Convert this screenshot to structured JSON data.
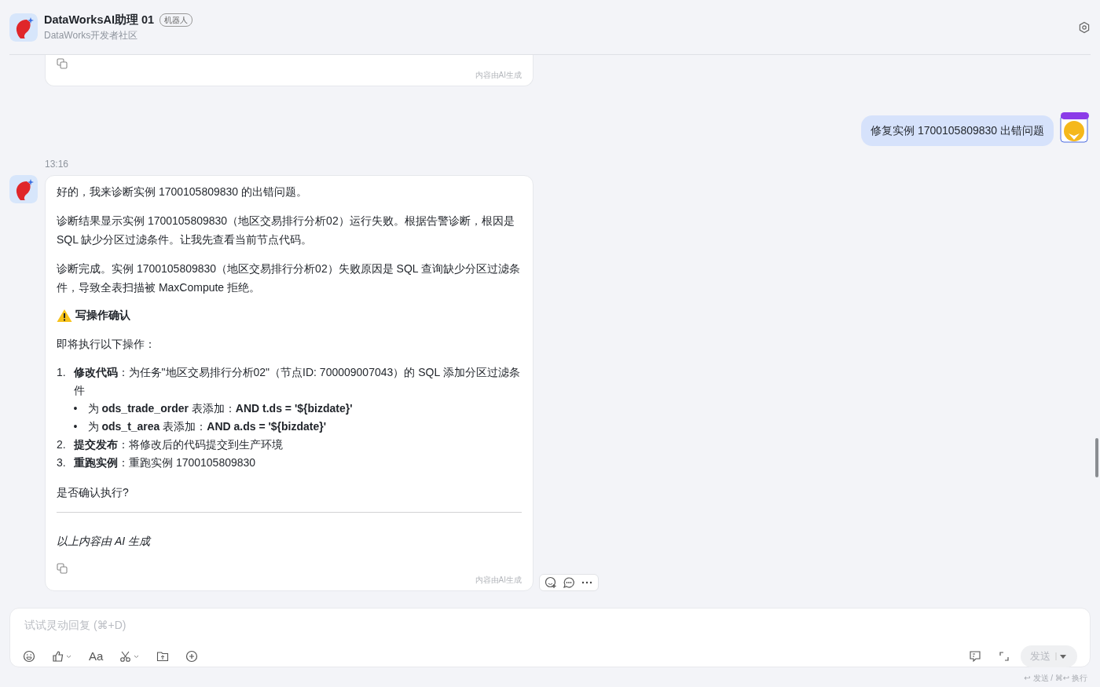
{
  "header": {
    "title": "DataWorksAI助理 01",
    "badge": "机器人",
    "subtitle": "DataWorks开发者社区"
  },
  "messages": [
    {
      "kind": "bot_partial",
      "footer": "内容由AI生成"
    },
    {
      "kind": "user",
      "text": "修复实例 1700105809830 出错问题"
    },
    {
      "kind": "bot",
      "time": "13:16",
      "footer": "内容由AI生成",
      "blocks": [
        {
          "kind": "para",
          "text": "好的，我来诊断实例 1700105809830 的出错问题。"
        },
        {
          "kind": "para",
          "text": "诊断结果显示实例 1700105809830（地区交易排行分析02）运行失败。根据告警诊断，根因是 SQL 缺少分区过滤条件。让我先查看当前节点代码。"
        },
        {
          "kind": "para",
          "text": "诊断完成。实例 1700105809830（地区交易排行分析02）失败原因是 SQL 查询缺少分区过滤条件，导致全表扫描被 MaxCompute 拒绝。"
        },
        {
          "kind": "warning",
          "text": "写操作确认"
        },
        {
          "kind": "para",
          "text": "即将执行以下操作："
        },
        {
          "kind": "ordered",
          "items": [
            {
              "number": "1.",
              "text": "**修改代码**：为任务\"地区交易排行分析02\"（节点ID: 700009007043）的 SQL 添加分区过滤条件",
              "children": [
                {
                  "bullet": "•",
                  "text": "为 **ods_trade_order** 表添加：**AND t.ds = '${bizdate}'**"
                },
                {
                  "bullet": "•",
                  "text": "为 **ods_t_area** 表添加：**AND a.ds = '${bizdate}'**"
                }
              ]
            },
            {
              "number": "2.",
              "text": "**提交发布**：将修改后的代码提交到生产环境"
            },
            {
              "number": "3.",
              "text": "**重跑实例**：重跑实例 1700105809830"
            }
          ]
        },
        {
          "kind": "para",
          "text": "是否确认执行?"
        },
        {
          "kind": "divider"
        },
        {
          "kind": "note",
          "text": "以上内容由 AI 生成"
        }
      ]
    }
  ],
  "input": {
    "placeholder": "试试灵动回复 (⌘+D)",
    "format_label": "Aa",
    "send_label": "发送",
    "hint": "↩ 发送 / ⌘↩ 换行"
  }
}
